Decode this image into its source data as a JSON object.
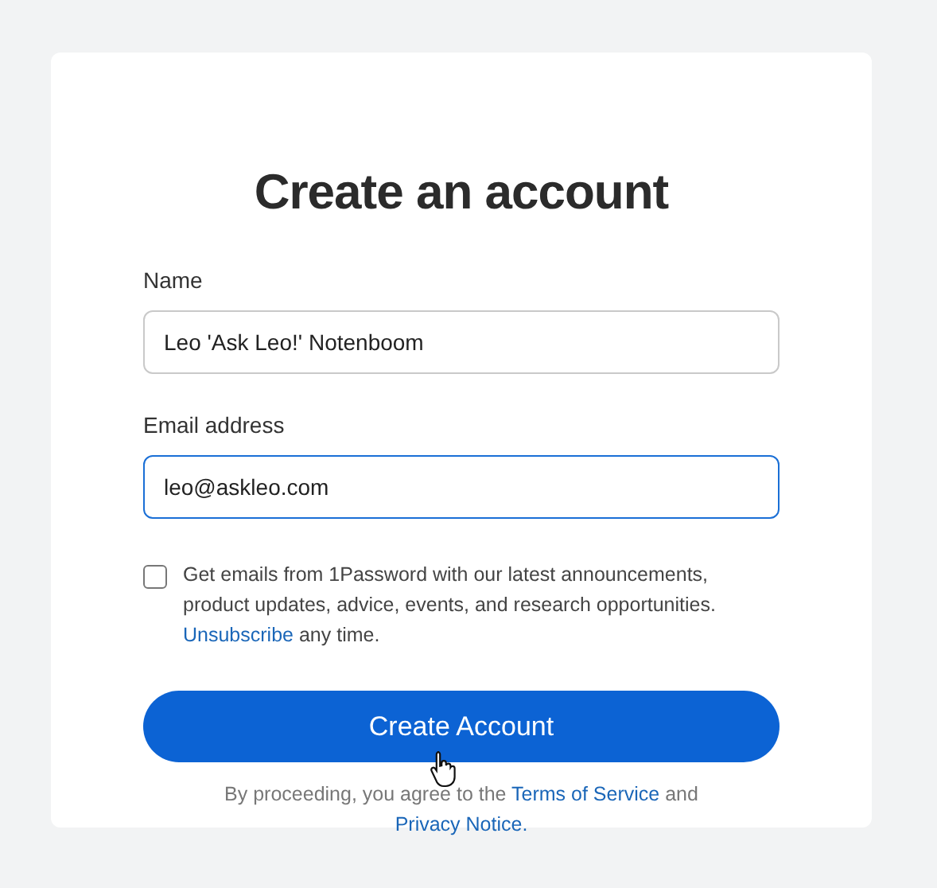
{
  "title": "Create an account",
  "fields": [
    {
      "label": "Name",
      "value": "Leo 'Ask Leo!' Notenboom",
      "focused": false
    },
    {
      "label": "Email address",
      "value": "leo@askleo.com",
      "focused": true
    }
  ],
  "consent": {
    "checked": false,
    "parts": [
      {
        "kind": "text",
        "text": "Get emails from 1Password with our latest announcements, product updates, advice, events, and research opportunities."
      },
      {
        "kind": "link",
        "text": "Unsubscribe"
      },
      {
        "kind": "text",
        "text": "any time."
      }
    ]
  },
  "submit": {
    "label": "Create Account",
    "hovered": true
  },
  "legal": [
    {
      "kind": "text",
      "text": "By proceeding, you agree to the"
    },
    {
      "kind": "link",
      "text": "Terms of Service"
    },
    {
      "kind": "text",
      "text": "and"
    },
    {
      "kind": "link",
      "text": "Privacy Notice."
    }
  ]
}
